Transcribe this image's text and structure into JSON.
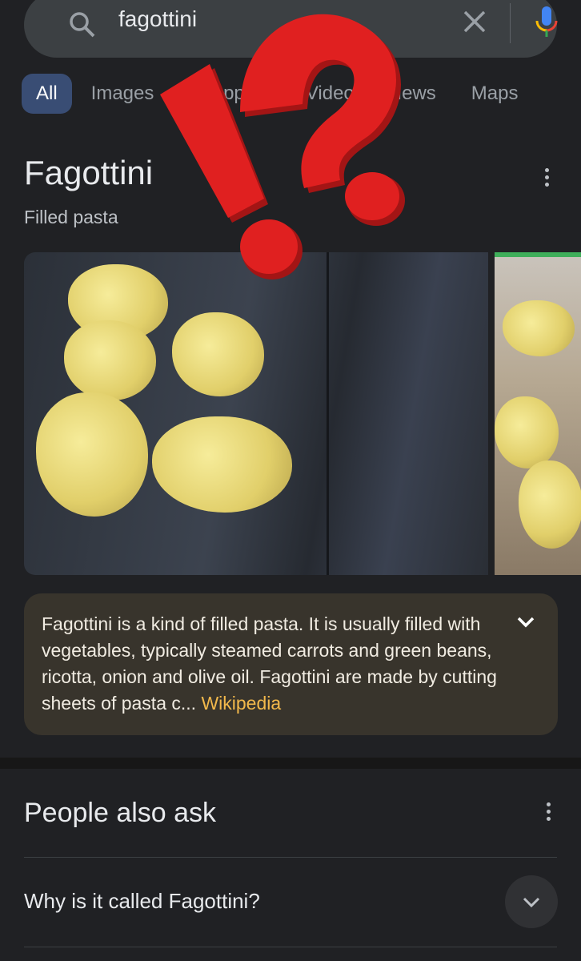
{
  "search": {
    "query": "fagottini",
    "search_icon": "search-icon",
    "clear_icon": "close-icon",
    "mic_icon": "microphone-icon"
  },
  "tabs": [
    {
      "label": "All",
      "active": true
    },
    {
      "label": "Images"
    },
    {
      "label": "Shopping"
    },
    {
      "label": "Videos"
    },
    {
      "label": "News"
    },
    {
      "label": "Maps"
    }
  ],
  "knowledge": {
    "title": "Fagottini",
    "subtitle": "Filled pasta",
    "description": "Fagottini is a kind of filled pasta. It is usually filled with vegetables, typically steamed carrots and green beans, ricotta, onion and olive oil. Fagottini are made by cutting sheets of pasta c...",
    "source": "Wikipedia"
  },
  "people_also_ask": {
    "heading": "People also ask",
    "questions": [
      "Why is it called Fagottini?"
    ]
  },
  "colors": {
    "accent": "#394d74",
    "link": "#f2b84b",
    "overlay": "#e02020",
    "background": "#202124"
  }
}
